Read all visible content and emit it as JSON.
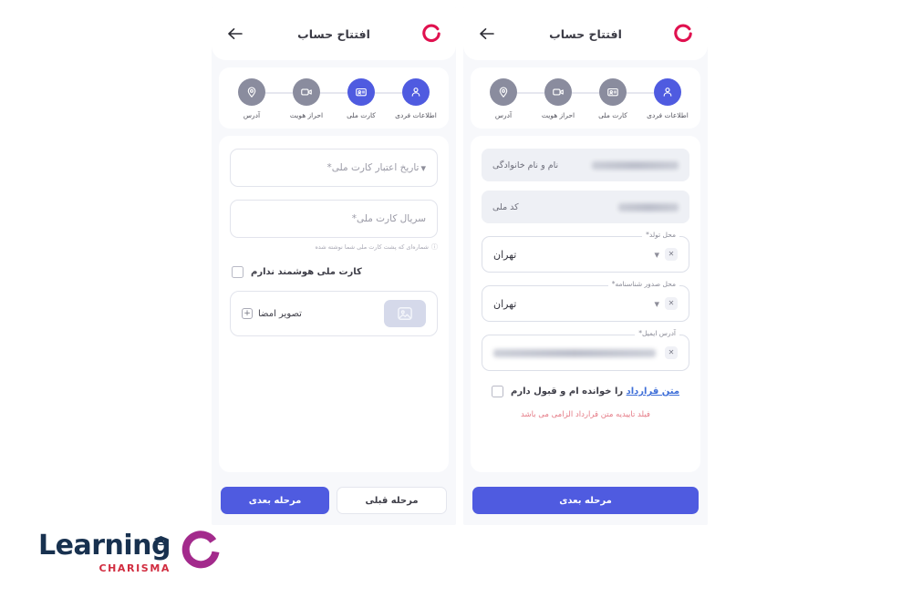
{
  "app": {
    "header_title": "افتتاح حساب",
    "back_icon": "arrow-left-icon",
    "brand_logo": "charisma-c-logo"
  },
  "colors": {
    "primary": "#4f5be0",
    "step_inactive": "#8a8c9e",
    "error": "#e57a86",
    "link": "#3f6fd8",
    "panel_bg": "#f7f8fb",
    "readonly_bg": "#eef0f5",
    "brand_pink": "#e0114f"
  },
  "steps": [
    {
      "label": "آدرس",
      "icon": "location-pin-icon"
    },
    {
      "label": "احراز هویت",
      "icon": "video-camera-icon"
    },
    {
      "label": "کارت ملی",
      "icon": "id-card-icon"
    },
    {
      "label": "اطلاعات فردی",
      "icon": "person-icon"
    }
  ],
  "left_screen": {
    "active_steps": [
      "کارت ملی",
      "اطلاعات فردی"
    ],
    "fields": [
      {
        "name": "national-card-expiry",
        "placeholder": "تاریخ اعتبار کارت ملی*",
        "value": "",
        "type": "select",
        "chevron": "chevron-down-icon"
      },
      {
        "name": "national-card-serial",
        "placeholder": "سریال کارت ملی*",
        "value": "",
        "type": "text",
        "hint": "شماره‌ای که پشت کارت ملی شما نوشته شده",
        "hint_icon": "info-icon"
      }
    ],
    "checkbox": {
      "label": "کارت ملی هوشمند ندارم",
      "checked": false
    },
    "signature": {
      "label": "تصویر امضا",
      "add_icon": "plus-square-icon",
      "thumb_icon": "image-placeholder-icon"
    },
    "buttons": {
      "next": "مرحله بعدی",
      "prev": "مرحله قبلی"
    }
  },
  "right_screen": {
    "active_steps": [
      "اطلاعات فردی"
    ],
    "readonly_fields": [
      {
        "name": "full-name",
        "label": "نام و نام خانوادگی",
        "value": "",
        "redacted": true
      },
      {
        "name": "national-code",
        "label": "کد ملی",
        "value": "",
        "redacted": true
      }
    ],
    "select_fields": [
      {
        "name": "birth-place",
        "legend": "محل تولد*",
        "value": "تهران",
        "clear_icon": "clear-x-icon",
        "chevron": "chevron-down-icon"
      },
      {
        "name": "id-issue-place",
        "legend": "محل صدور شناسنامه*",
        "value": "تهران",
        "clear_icon": "clear-x-icon",
        "chevron": "chevron-down-icon"
      }
    ],
    "email_field": {
      "name": "email-address",
      "legend": "آدرس ایمیل*",
      "value": "",
      "redacted": true,
      "clear_icon": "clear-x-icon"
    },
    "agreement": {
      "link_label": "متن قرارداد",
      "text_after": "را خوانده ام و قبول دارم",
      "checked": false,
      "error": "فیلد تاییدیه متن قرارداد الزامی می باشد"
    },
    "buttons": {
      "next": "مرحله بعدی"
    }
  },
  "watermark": {
    "title": "Learning",
    "subtitle": "CHARISMA",
    "mark": "c-arc-logo",
    "cap_icon": "graduation-cap-icon"
  }
}
